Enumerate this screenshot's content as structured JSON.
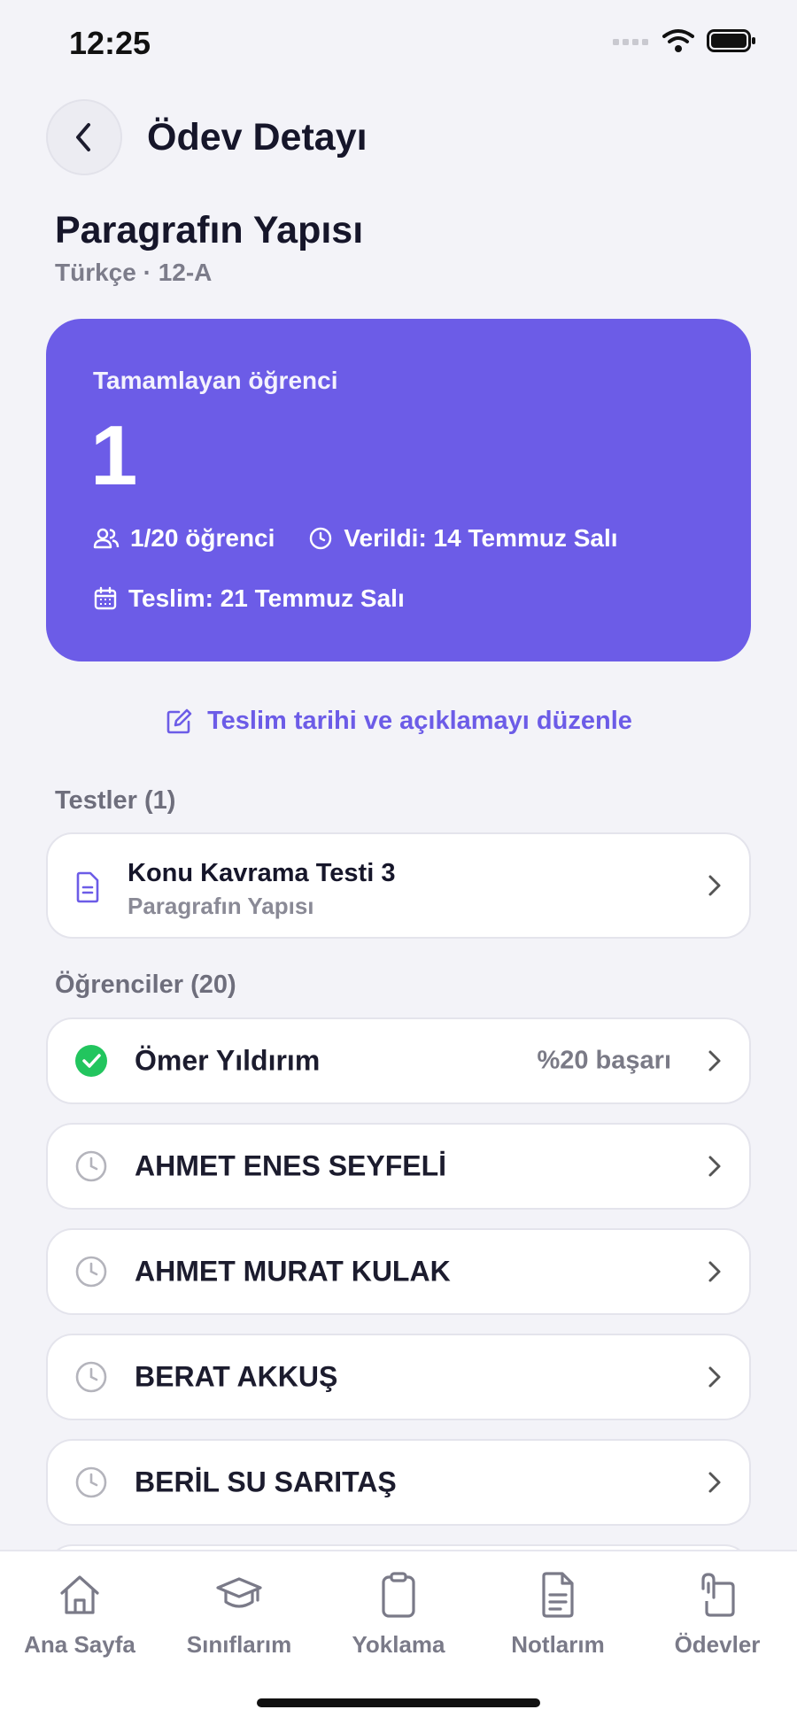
{
  "status_bar": {
    "time": "12:25"
  },
  "header": {
    "title": "Ödev Detayı"
  },
  "assignment": {
    "title": "Paragrafın Yapısı",
    "subtitle": "Türkçe · 12-A"
  },
  "summary": {
    "label": "Tamamlayan öğrenci",
    "value": "1",
    "students": "1/20 öğrenci",
    "given": "Verildi: 14 Temmuz Salı",
    "due": "Teslim: 21 Temmuz Salı",
    "accent": "#6c5ce7"
  },
  "edit_link": "Teslim tarihi ve açıklamayı düzenle",
  "tests": {
    "label": "Testler (1)",
    "items": [
      {
        "title": "Konu Kavrama Testi 3",
        "subtitle": "Paragrafın Yapısı"
      }
    ]
  },
  "students": {
    "label": "Öğrenciler (20)",
    "items": [
      {
        "name": "Ömer Yıldırım",
        "status": "completed",
        "score": "%20 başarı"
      },
      {
        "name": "AHMET ENES SEYFELİ",
        "status": "pending"
      },
      {
        "name": "AHMET MURAT KULAK",
        "status": "pending"
      },
      {
        "name": "BERAT AKKUŞ",
        "status": "pending"
      },
      {
        "name": "BERİL SU SARITAŞ",
        "status": "pending"
      }
    ]
  },
  "tabbar": {
    "items": [
      {
        "label": "Ana Sayfa",
        "icon": "home-icon"
      },
      {
        "label": "Sınıflarım",
        "icon": "graduation-cap-icon"
      },
      {
        "label": "Yoklama",
        "icon": "clipboard-icon"
      },
      {
        "label": "Notlarım",
        "icon": "document-icon"
      },
      {
        "label": "Ödevler",
        "icon": "paperclip-icon"
      }
    ]
  }
}
